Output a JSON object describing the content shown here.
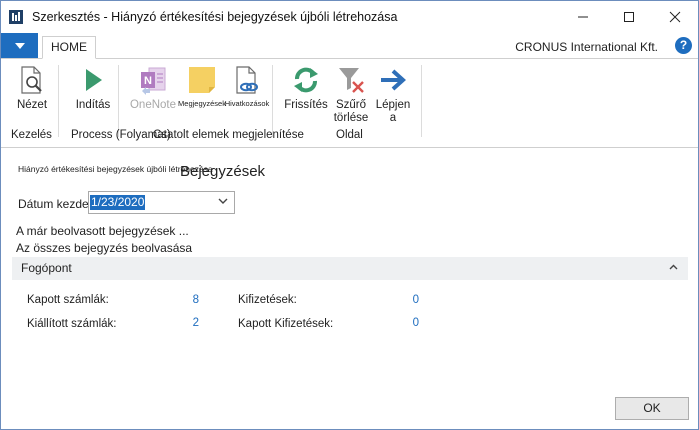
{
  "window": {
    "title": "Szerkesztés - Hiányzó értékesítési bejegyzések újbóli létrehozása"
  },
  "ribbon": {
    "tab_home": "HOME",
    "company": "CRONUS International Kft.",
    "help": "?",
    "buttons": {
      "view": "Nézet",
      "start": "Indítás",
      "onenote": "OneNote",
      "notes": "Megjegyzések",
      "links": "Hivatkozások",
      "refresh": "Frissítés",
      "clear_filter_1": "Szűrő",
      "clear_filter_2": "törlése",
      "goto_1": "Lépjen",
      "goto_2": "a"
    },
    "groups": {
      "manage": "Kezelés",
      "process": "Process (Folyamat)",
      "attached": "Csatolt elemek megjelenítése",
      "page": "Oldal"
    }
  },
  "page": {
    "breadcrumb": "Hiányzó értékesítési bejegyzések újbóli létrehozása",
    "title": "Bejegyzések",
    "date_label": "Dátum kezdete",
    "date_value": "1/23/2020",
    "link_read_already": "A már beolvasott bejegyzések ...",
    "link_read_all": "Az összes bejegyzés beolvasása"
  },
  "fasttab": {
    "title": "Fogópont",
    "fields": {
      "received_invoices_label": "Kapott számlák:",
      "received_invoices_value": "8",
      "issued_invoices_label": "Kiállított számlák:",
      "issued_invoices_value": "2",
      "payments_label": "Kifizetések:",
      "payments_value": "0",
      "received_payments_label": "Kapott Kifizetések:",
      "received_payments_value": "0"
    }
  },
  "footer": {
    "ok": "OK"
  },
  "colors": {
    "accent": "#1e6dbf",
    "start_green": "#3b9a6e",
    "onenote_purple": "#b07bc0",
    "notes_yellow": "#f5d062",
    "refresh_green": "#3b9a6e",
    "filter_red": "#d9534f"
  }
}
